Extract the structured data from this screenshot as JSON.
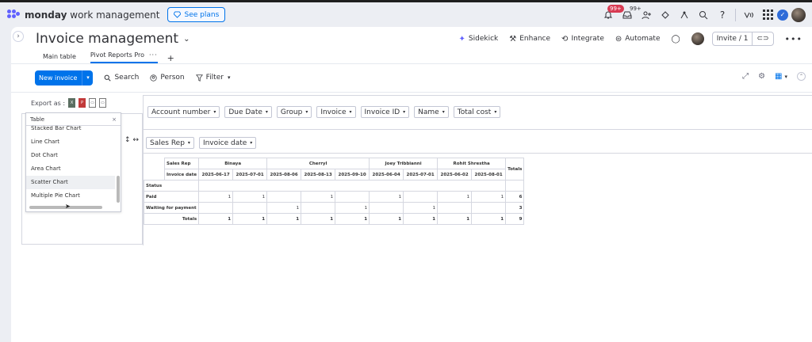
{
  "topbar": {
    "brand_bold": "monday",
    "brand_rest": " work management",
    "see_plans": "See plans",
    "notifications_badge": "99+",
    "inbox_badge": "99+"
  },
  "board": {
    "title": "Invoice management",
    "actions": {
      "sidekick": "Sidekick",
      "enhance": "Enhance",
      "integrate": "Integrate",
      "automate": "Automate",
      "invite": "Invite / 1"
    },
    "tabs": [
      {
        "label": "Main table"
      },
      {
        "label": "Pivot Reports Pro"
      }
    ]
  },
  "toolbar": {
    "new_invoice": "New invoice",
    "search": "Search",
    "person": "Person",
    "filter": "Filter"
  },
  "pivot": {
    "export_label": "Export as :",
    "dropdown": {
      "selected": "Table",
      "items": [
        "Stacked Bar Chart",
        "Line Chart",
        "Dot Chart",
        "Area Chart",
        "Scatter Chart",
        "Multiple Pie Chart"
      ]
    },
    "filter_fields": [
      "Account number",
      "Due Date",
      "Group",
      "Invoice",
      "Invoice ID",
      "Name",
      "Total cost"
    ],
    "column_fields": [
      "Sales Rep",
      "Invoice date"
    ],
    "table": {
      "sales_rep_label": "Sales Rep",
      "invoice_date_label": "Invoice date",
      "status_label": "Status",
      "totals_label": "Totals",
      "reps": [
        {
          "name": "Binaya",
          "dates": [
            "2025-06-17",
            "2025-07-01"
          ]
        },
        {
          "name": "Cherryl",
          "dates": [
            "2025-08-06",
            "2025-08-13",
            "2025-09-10"
          ]
        },
        {
          "name": "Joey Tribbianni",
          "dates": [
            "2025-06-04",
            "2025-07-01"
          ]
        },
        {
          "name": "Rohit Shrestha",
          "dates": [
            "2025-06-02",
            "2025-08-01"
          ]
        }
      ],
      "rows": [
        {
          "status": "Paid",
          "values": [
            "1",
            "1",
            "",
            "1",
            "",
            "1",
            "",
            "1",
            "1"
          ],
          "total": "6"
        },
        {
          "status": "Waiting for payment",
          "values": [
            "",
            "",
            "1",
            "",
            "1",
            "",
            "1",
            "",
            ""
          ],
          "total": "3"
        }
      ],
      "totals_row": {
        "label": "Totals",
        "values": [
          "1",
          "1",
          "1",
          "1",
          "1",
          "1",
          "1",
          "1",
          "1"
        ],
        "total": "9"
      }
    }
  }
}
